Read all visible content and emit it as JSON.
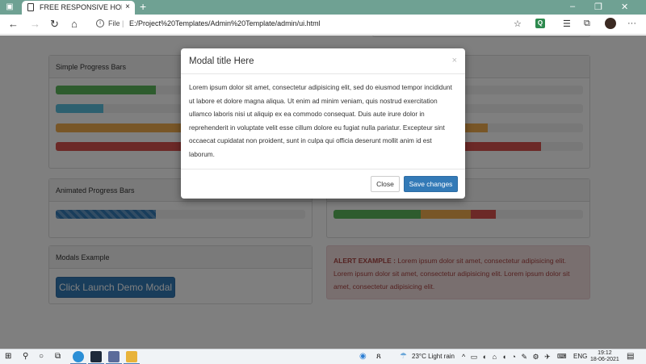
{
  "browser": {
    "tab_title": "FREE RESPONSIVE HORIZONTAL",
    "tab_close": "×",
    "new_tab": "+",
    "url_scheme": "File",
    "url_separator": "|",
    "url": "E:/Project%20Templates/Admin%20Template/admin/ui.html",
    "window_controls": [
      "–",
      "❐",
      "✕"
    ],
    "toolbar_icons": [
      "star-add-icon",
      "extension-q-icon",
      "favorites-icon",
      "collections-icon",
      "profile-icon",
      "menu-icon"
    ],
    "extension_label": "Q",
    "more_label": "···"
  },
  "page": {
    "simple_progress": {
      "title": "Simple Progress Bars",
      "bars": [
        {
          "color": "#5cb85c",
          "value": 0.19
        },
        {
          "color": "#5bc0de",
          "value": 0.09
        },
        {
          "color": "#f0ad4e",
          "value": 0.82
        },
        {
          "color": "#d9534f",
          "value": 0.92
        }
      ]
    },
    "animated_progress": {
      "title": "Animated Progress Bars",
      "bars": [
        {
          "color": "#337ab7",
          "value": 0.4,
          "striped": true
        }
      ]
    },
    "stacked_progress": {
      "segments": [
        {
          "color": "#5cb85c",
          "value": 0.35
        },
        {
          "color": "#f0ad4e",
          "value": 0.2
        },
        {
          "color": "#d9534f",
          "value": 0.1
        }
      ]
    },
    "modals_example": {
      "title": "Modals Example",
      "button_label": "Click Launch Demo Modal"
    },
    "alert": {
      "strong": "ALERT EXAMPLE :",
      "text": " Lorem ipsum dolor sit amet, consectetur adipisicing elit. Lorem ipsum dolor sit amet, consectetur adipisicing elit. Lorem ipsum dolor sit amet, consectetur adipisicing elit."
    }
  },
  "modal": {
    "title": "Modal title Here",
    "close_x": "×",
    "body": "Lorem ipsum dolor sit amet, consectetur adipisicing elit, sed do eiusmod tempor incididunt ut labore et dolore magna aliqua. Ut enim ad minim veniam, quis nostrud exercitation ullamco laboris nisi ut aliquip ex ea commodo consequat. Duis aute irure dolor in reprehenderit in voluptate velit esse cillum dolore eu fugiat nulla pariatur. Excepteur sint occaecat cupidatat non proident, sunt in culpa qui officia deserunt mollit anim id est laborum.",
    "close_button": "Close",
    "save_button": "Save changes"
  },
  "taskbar": {
    "weather": "23°C  Light rain",
    "language": "ENG",
    "time": "19:12",
    "date": "18-06-2021"
  }
}
